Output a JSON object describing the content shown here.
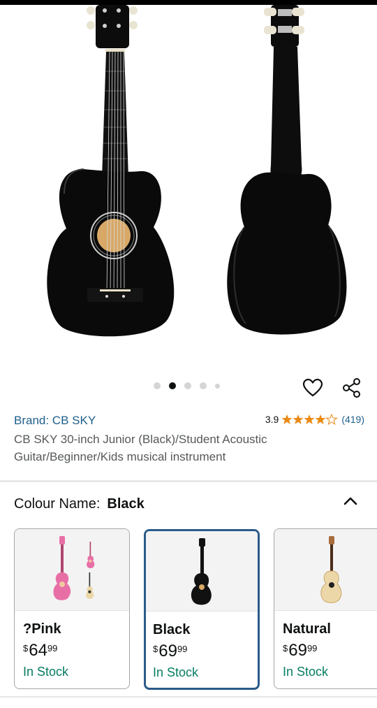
{
  "gallery": {
    "image_alt": "CB SKY 30-inch Junior Acoustic Guitar front and back views",
    "dot_count": 5,
    "active_dot": 1
  },
  "actions": {
    "wishlist_icon": "heart-outline-icon",
    "share_icon": "share-icon"
  },
  "product": {
    "brand": "Brand: CB SKY",
    "rating": "3.9",
    "rating_value": 3.9,
    "review_count": "(419)",
    "title": "CB SKY 30-inch Junior (Black)/Student Acoustic Guitar/Beginner/Kids musical instrument"
  },
  "variation": {
    "label": "Colour Name:",
    "selected": "Black",
    "collapse_icon": "chevron-up-icon"
  },
  "swatches": [
    {
      "name": "?Pink",
      "currency": "$",
      "whole": "64",
      "cents": "99",
      "stock": "In Stock",
      "color": "#e86fa6",
      "selected": false
    },
    {
      "name": "Black",
      "currency": "$",
      "whole": "69",
      "cents": "99",
      "stock": "In Stock",
      "color": "#111111",
      "selected": true
    },
    {
      "name": "Natural",
      "currency": "$",
      "whole": "69",
      "cents": "99",
      "stock": "In Stock",
      "color": "#e8d3a3",
      "selected": false
    }
  ],
  "colors": {
    "link": "#1f5f8b",
    "in_stock": "#067d62",
    "star": "#e98a15",
    "selected_border": "#2b5b8a"
  }
}
